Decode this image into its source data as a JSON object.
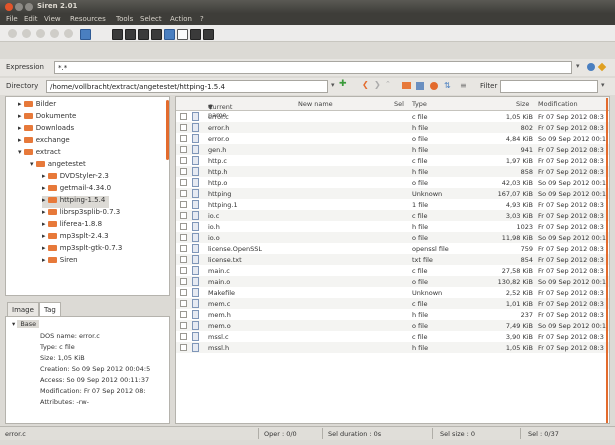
{
  "window": {
    "title": "Siren 2.01",
    "menu": [
      "File",
      "Edit",
      "View",
      "Resources",
      "Tools",
      "Select",
      "Action",
      "?"
    ]
  },
  "expression": {
    "label": "Expression",
    "value": "*.*"
  },
  "directory": {
    "label": "Directory",
    "value": "/home/vollbracht/extract/angetestet/httping-1.5.4",
    "filter_label": "Filter",
    "filter_value": ""
  },
  "tree": {
    "items": [
      {
        "label": "Bilder",
        "level": 1,
        "expander": "▸"
      },
      {
        "label": "Dokumente",
        "level": 1,
        "expander": "▸"
      },
      {
        "label": "Downloads",
        "level": 1,
        "expander": "▸"
      },
      {
        "label": "exchange",
        "level": 1,
        "expander": "▸"
      },
      {
        "label": "extract",
        "level": 1,
        "expander": "▾"
      },
      {
        "label": "angetestet",
        "level": 2,
        "expander": "▾"
      },
      {
        "label": "DVDStyler-2.3",
        "level": 3,
        "expander": "▸"
      },
      {
        "label": "getmail-4.34.0",
        "level": 3,
        "expander": "▸"
      },
      {
        "label": "httping-1.5.4",
        "level": 3,
        "expander": "▸",
        "selected": true
      },
      {
        "label": "librsp3splib-0.7.3",
        "level": 3,
        "expander": "▸"
      },
      {
        "label": "liferea-1.8.8",
        "level": 3,
        "expander": "▸"
      },
      {
        "label": "mp3splt-2.4.3",
        "level": 3,
        "expander": "▸"
      },
      {
        "label": "mp3splt-gtk-0.7.3",
        "level": 3,
        "expander": "▸"
      },
      {
        "label": "Siren",
        "level": 3,
        "expander": "▸"
      }
    ]
  },
  "tabs": {
    "image": "Image",
    "tag": "Tag"
  },
  "properties": {
    "group": "Base",
    "lines": [
      "DOS name: error.c",
      "Type: c file",
      "Size: 1,05 KiB",
      "Creation: So 09 Sep 2012 00:04:5",
      "Access: So 09 Sep 2012 00:11:37",
      "Modification: Fr 07 Sep 2012 08:",
      "Attributes: -rw-"
    ]
  },
  "list": {
    "columns": {
      "current_name": "Current name",
      "sort_indicator": "▼",
      "new_name": "New name",
      "sel": "Sel",
      "type": "Type",
      "size": "Size",
      "modification": "Modification"
    },
    "rows": [
      {
        "name": "error.c",
        "type": "c file",
        "size": "1,05 KiB",
        "mod": "Fr 07 Sep 2012 08:3"
      },
      {
        "name": "error.h",
        "type": "h file",
        "size": "802",
        "mod": "Fr 07 Sep 2012 08:3"
      },
      {
        "name": "error.o",
        "type": "o file",
        "size": "4,84 KiB",
        "mod": "So 09 Sep 2012 00:1"
      },
      {
        "name": "gen.h",
        "type": "h file",
        "size": "941",
        "mod": "Fr 07 Sep 2012 08:3"
      },
      {
        "name": "http.c",
        "type": "c file",
        "size": "1,97 KiB",
        "mod": "Fr 07 Sep 2012 08:3"
      },
      {
        "name": "http.h",
        "type": "h file",
        "size": "858",
        "mod": "Fr 07 Sep 2012 08:3"
      },
      {
        "name": "http.o",
        "type": "o file",
        "size": "42,03 KiB",
        "mod": "So 09 Sep 2012 00:1"
      },
      {
        "name": "httping",
        "type": "Unknown",
        "size": "167,07 KiB",
        "mod": "So 09 Sep 2012 00:1"
      },
      {
        "name": "httping.1",
        "type": "1 file",
        "size": "4,93 KiB",
        "mod": "Fr 07 Sep 2012 08:3"
      },
      {
        "name": "io.c",
        "type": "c file",
        "size": "3,03 KiB",
        "mod": "Fr 07 Sep 2012 08:3"
      },
      {
        "name": "io.h",
        "type": "h file",
        "size": "1023",
        "mod": "Fr 07 Sep 2012 08:3"
      },
      {
        "name": "io.o",
        "type": "o file",
        "size": "11,98 KiB",
        "mod": "So 09 Sep 2012 00:1"
      },
      {
        "name": "license.OpenSSL",
        "type": "openssl file",
        "size": "759",
        "mod": "Fr 07 Sep 2012 08:3"
      },
      {
        "name": "license.txt",
        "type": "txt file",
        "size": "854",
        "mod": "Fr 07 Sep 2012 08:3"
      },
      {
        "name": "main.c",
        "type": "c file",
        "size": "27,58 KiB",
        "mod": "Fr 07 Sep 2012 08:3"
      },
      {
        "name": "main.o",
        "type": "o file",
        "size": "130,82 KiB",
        "mod": "So 09 Sep 2012 00:1"
      },
      {
        "name": "Makefile",
        "type": "Unknown",
        "size": "2,52 KiB",
        "mod": "Fr 07 Sep 2012 08:3"
      },
      {
        "name": "mem.c",
        "type": "c file",
        "size": "1,01 KiB",
        "mod": "Fr 07 Sep 2012 08:3"
      },
      {
        "name": "mem.h",
        "type": "h file",
        "size": "237",
        "mod": "Fr 07 Sep 2012 08:3"
      },
      {
        "name": "mem.o",
        "type": "o file",
        "size": "7,49 KiB",
        "mod": "So 09 Sep 2012 00:1"
      },
      {
        "name": "mssl.c",
        "type": "c file",
        "size": "3,90 KiB",
        "mod": "Fr 07 Sep 2012 08:3"
      },
      {
        "name": "mssl.h",
        "type": "h file",
        "size": "1,05 KiB",
        "mod": "Fr 07 Sep 2012 08:3"
      }
    ]
  },
  "status": {
    "file": "error.c",
    "oper": "Oper : 0/0",
    "sel_duration": "Sel duration : 0s",
    "sel_size": "Sel size : 0",
    "sel": "Sel : 0/37"
  },
  "colors": {
    "accent": "#e36b2d",
    "titlebar": "#3d3c38",
    "folder": "#e7793a"
  }
}
